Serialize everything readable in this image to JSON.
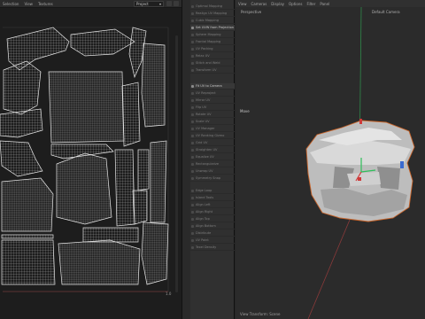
{
  "uv_editor": {
    "menu": [
      "Selection",
      "View",
      "Textures"
    ],
    "project_select": "Project",
    "corner_label": "1.0"
  },
  "tool_panel": {
    "items": [
      {
        "label": "Optimal Mapping",
        "on": false
      },
      {
        "label": "Realign UV Mapping",
        "on": false
      },
      {
        "label": "Cubic Mapping",
        "on": false
      },
      {
        "label": "Set UVW from Projection",
        "on": true
      },
      {
        "label": "Sphere Mapping",
        "on": false
      },
      {
        "label": "Frontal Mapping",
        "on": false
      },
      {
        "label": "UV Packing",
        "on": false
      },
      {
        "label": "Relax UV",
        "on": false
      },
      {
        "label": "Stitch and Weld",
        "on": false
      },
      {
        "label": "Transform UV",
        "on": false
      },
      {
        "label": "Fit UV to Camera",
        "on": true
      },
      {
        "label": "UV Reproject",
        "on": false
      },
      {
        "label": "Mirror UV",
        "on": false
      },
      {
        "label": "Flip UV",
        "on": false
      },
      {
        "label": "Rotate UV",
        "on": false
      },
      {
        "label": "Scale UV",
        "on": false
      },
      {
        "label": "UV Manager",
        "on": false
      },
      {
        "label": "UV Ranking Gizmo",
        "on": false
      },
      {
        "label": "Grid UV",
        "on": false
      },
      {
        "label": "Straighten UV",
        "on": false
      },
      {
        "label": "Equalize UV",
        "on": false
      },
      {
        "label": "Rectangularize",
        "on": false
      },
      {
        "label": "Unwrap UV",
        "on": false
      },
      {
        "label": "Symmetry Snap",
        "on": false
      },
      {
        "label": "Edge Loop",
        "on": false
      },
      {
        "label": "Island Tools",
        "on": false
      },
      {
        "label": "Align Left",
        "on": false
      },
      {
        "label": "Align Right",
        "on": false
      },
      {
        "label": "Align Top",
        "on": false
      },
      {
        "label": "Align Bottom",
        "on": false
      },
      {
        "label": "Distribute",
        "on": false
      },
      {
        "label": "UV Paint",
        "on": false
      },
      {
        "label": "Texel Density",
        "on": false
      }
    ]
  },
  "viewport": {
    "menu": [
      "View",
      "Cameras",
      "Display",
      "Options",
      "Filter",
      "Panel"
    ],
    "perspective_label": "Perspective",
    "camera_label": "Default Camera",
    "tool_label": "Move",
    "status_label": "View Transform: Scene",
    "colors": {
      "y_axis": "#2f8a4a",
      "x_axis": "#8a3a3a",
      "selection_outline": "#c8642a"
    }
  }
}
